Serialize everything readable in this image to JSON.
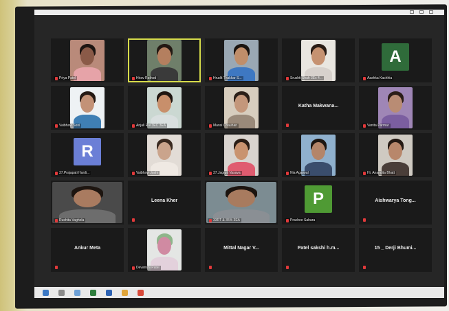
{
  "meeting": {
    "participants": [
      {
        "label": "Priya Patel",
        "kind": "video",
        "bg": "#b98a7a",
        "skin": "#8a5a48",
        "hair": "#1e1512",
        "shirt": "#e6a3a8"
      },
      {
        "label": "Hirav Rathod",
        "kind": "video",
        "bg": "#6f7f6a",
        "skin": "#b47f5f",
        "hair": "#231913",
        "shirt": "#3a3a3a",
        "active": true
      },
      {
        "label": "Hrudit Thakkar S...",
        "kind": "video",
        "bg": "#9aa8b4",
        "skin": "#c08e6a",
        "hair": "#1a1410",
        "shirt": "#3e78c2"
      },
      {
        "label": "Srushti Shah 3Ec 4...",
        "kind": "video",
        "bg": "#e9e6e0",
        "skin": "#c69271",
        "hair": "#2a1c15",
        "shirt": "#d7d1cc"
      },
      {
        "label": "Aashka Kachhia",
        "kind": "avatar",
        "initial": "A",
        "color": "#2f6b3a"
      },
      {
        "label": "Vaibhavi Soni",
        "kind": "video",
        "bg": "#eef2f4",
        "skin": "#c39277",
        "hair": "#251a14",
        "shirt": "#3f7fb4"
      },
      {
        "label": "Anjali Rai 3EC 3EA",
        "kind": "video",
        "bg": "#cbd8d2",
        "skin": "#c88f6b",
        "hair": "#1f1611",
        "shirt": "#d9dfdf"
      },
      {
        "label": "Mansi Chauhan",
        "kind": "video",
        "bg": "#d7cdbe",
        "skin": "#c4977b",
        "hair": "#2b1f18",
        "shirt": "#9a8a7a"
      },
      {
        "label": "Katha Makwana...",
        "kind": "name"
      },
      {
        "label": "Vanita Parmar",
        "kind": "video",
        "bg": "#9f86b6",
        "skin": "#b98c74",
        "hair": "#2b1d17",
        "shirt": "#7b5ea0"
      },
      {
        "label": "37.Prajapati Hardi...",
        "kind": "avatar",
        "initial": "R",
        "color": "#6b7fd6"
      },
      {
        "label": "Vaibhavi Joshi",
        "kind": "video",
        "bg": "#e2dcd6",
        "skin": "#caa48c",
        "hair": "#3a2a20",
        "shirt": "#efe9e3"
      },
      {
        "label": "37.Jagruti Vasava",
        "kind": "video",
        "bg": "#d9d4cf",
        "skin": "#c9936f",
        "hair": "#2a1d15",
        "shirt": "#e05c70"
      },
      {
        "label": "Nia Agarwal",
        "kind": "video",
        "bg": "#8fb0cd",
        "skin": "#b48569",
        "hair": "#1e1611",
        "shirt": "#3a4d6c"
      },
      {
        "label": "Hi, Anandita Bhatt",
        "kind": "video",
        "bg": "#cfcac2",
        "skin": "#b8876b",
        "hair": "#241913",
        "shirt": "#4a3e39"
      },
      {
        "label": "Rushita Vaghela",
        "kind": "video",
        "bg": "#4a4a4a",
        "skin": "#a97b60",
        "hair": "#1d1510",
        "shirt": "#6d6d6d",
        "wide": true
      },
      {
        "label": "Leena Kher",
        "kind": "name"
      },
      {
        "label": "33RT & 35% 3EA",
        "kind": "video",
        "bg": "#7c8c92",
        "skin": "#a87b5f",
        "hair": "#1c140f",
        "shirt": "#8a8f94",
        "wide": true
      },
      {
        "label": "Prachee Sahara",
        "kind": "avatar",
        "initial": "P",
        "color": "#4f9a34"
      },
      {
        "label": "Aishwarya Tong...",
        "kind": "name"
      },
      {
        "label": "Ankur Meta",
        "kind": "name"
      },
      {
        "label": "Devanshi Patel",
        "kind": "video",
        "bg": "#e4e6e4",
        "skin": "#d08aa2",
        "hair": "#8eb58a",
        "shirt": "#e3d1dc"
      },
      {
        "label": "Mittal Nagar V...",
        "kind": "name"
      },
      {
        "label": "Patel sakshi h.m...",
        "kind": "name"
      },
      {
        "label": "15 _ Derji Bhumi...",
        "kind": "name"
      }
    ]
  },
  "icons": [
    "minimize-icon",
    "maximize-icon",
    "close-icon",
    "mic-muted-icon"
  ],
  "colors": {
    "screen_bg": "#262626",
    "tile_bg": "#1a1a1a",
    "active_border": "#d7dc4a",
    "muted_red": "#e0393a"
  }
}
